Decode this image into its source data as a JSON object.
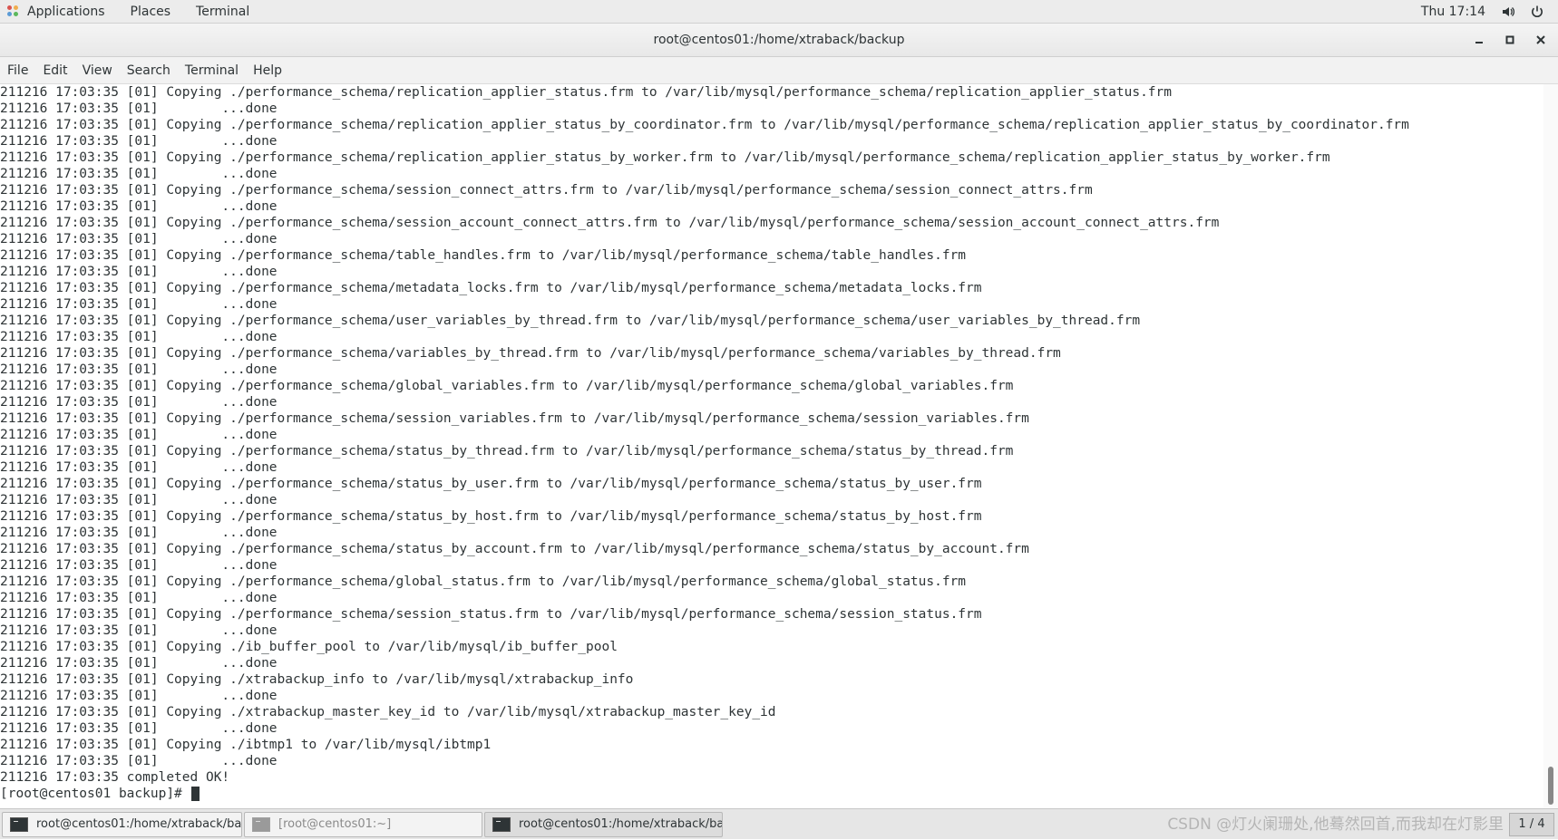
{
  "topbar": {
    "menu": [
      "Applications",
      "Places",
      "Terminal"
    ],
    "clock": "Thu 17:14",
    "icons": [
      "applications-icon",
      "volume-icon",
      "power-icon"
    ]
  },
  "window": {
    "title": "root@centos01:/home/xtraback/backup",
    "controls": [
      "minimize-icon",
      "maximize-icon",
      "close-icon"
    ]
  },
  "menubar": [
    "File",
    "Edit",
    "View",
    "Search",
    "Terminal",
    "Help"
  ],
  "terminal": {
    "lines": [
      "211216 17:03:35 [01] Copying ./performance_schema/replication_applier_status.frm to /var/lib/mysql/performance_schema/replication_applier_status.frm",
      "211216 17:03:35 [01]        ...done",
      "211216 17:03:35 [01] Copying ./performance_schema/replication_applier_status_by_coordinator.frm to /var/lib/mysql/performance_schema/replication_applier_status_by_coordinator.frm",
      "211216 17:03:35 [01]        ...done",
      "211216 17:03:35 [01] Copying ./performance_schema/replication_applier_status_by_worker.frm to /var/lib/mysql/performance_schema/replication_applier_status_by_worker.frm",
      "211216 17:03:35 [01]        ...done",
      "211216 17:03:35 [01] Copying ./performance_schema/session_connect_attrs.frm to /var/lib/mysql/performance_schema/session_connect_attrs.frm",
      "211216 17:03:35 [01]        ...done",
      "211216 17:03:35 [01] Copying ./performance_schema/session_account_connect_attrs.frm to /var/lib/mysql/performance_schema/session_account_connect_attrs.frm",
      "211216 17:03:35 [01]        ...done",
      "211216 17:03:35 [01] Copying ./performance_schema/table_handles.frm to /var/lib/mysql/performance_schema/table_handles.frm",
      "211216 17:03:35 [01]        ...done",
      "211216 17:03:35 [01] Copying ./performance_schema/metadata_locks.frm to /var/lib/mysql/performance_schema/metadata_locks.frm",
      "211216 17:03:35 [01]        ...done",
      "211216 17:03:35 [01] Copying ./performance_schema/user_variables_by_thread.frm to /var/lib/mysql/performance_schema/user_variables_by_thread.frm",
      "211216 17:03:35 [01]        ...done",
      "211216 17:03:35 [01] Copying ./performance_schema/variables_by_thread.frm to /var/lib/mysql/performance_schema/variables_by_thread.frm",
      "211216 17:03:35 [01]        ...done",
      "211216 17:03:35 [01] Copying ./performance_schema/global_variables.frm to /var/lib/mysql/performance_schema/global_variables.frm",
      "211216 17:03:35 [01]        ...done",
      "211216 17:03:35 [01] Copying ./performance_schema/session_variables.frm to /var/lib/mysql/performance_schema/session_variables.frm",
      "211216 17:03:35 [01]        ...done",
      "211216 17:03:35 [01] Copying ./performance_schema/status_by_thread.frm to /var/lib/mysql/performance_schema/status_by_thread.frm",
      "211216 17:03:35 [01]        ...done",
      "211216 17:03:35 [01] Copying ./performance_schema/status_by_user.frm to /var/lib/mysql/performance_schema/status_by_user.frm",
      "211216 17:03:35 [01]        ...done",
      "211216 17:03:35 [01] Copying ./performance_schema/status_by_host.frm to /var/lib/mysql/performance_schema/status_by_host.frm",
      "211216 17:03:35 [01]        ...done",
      "211216 17:03:35 [01] Copying ./performance_schema/status_by_account.frm to /var/lib/mysql/performance_schema/status_by_account.frm",
      "211216 17:03:35 [01]        ...done",
      "211216 17:03:35 [01] Copying ./performance_schema/global_status.frm to /var/lib/mysql/performance_schema/global_status.frm",
      "211216 17:03:35 [01]        ...done",
      "211216 17:03:35 [01] Copying ./performance_schema/session_status.frm to /var/lib/mysql/performance_schema/session_status.frm",
      "211216 17:03:35 [01]        ...done",
      "211216 17:03:35 [01] Copying ./ib_buffer_pool to /var/lib/mysql/ib_buffer_pool",
      "211216 17:03:35 [01]        ...done",
      "211216 17:03:35 [01] Copying ./xtrabackup_info to /var/lib/mysql/xtrabackup_info",
      "211216 17:03:35 [01]        ...done",
      "211216 17:03:35 [01] Copying ./xtrabackup_master_key_id to /var/lib/mysql/xtrabackup_master_key_id",
      "211216 17:03:35 [01]        ...done",
      "211216 17:03:35 [01] Copying ./ibtmp1 to /var/lib/mysql/ibtmp1",
      "211216 17:03:35 [01]        ...done",
      "211216 17:03:35 completed OK!"
    ],
    "prompt": "[root@centos01 backup]# "
  },
  "taskbar": {
    "tasks": [
      {
        "label": "root@centos01:/home/xtraback/ba...",
        "state": "normal"
      },
      {
        "label": "[root@centos01:~]",
        "state": "dim"
      },
      {
        "label": "root@centos01:/home/xtraback/bac...",
        "state": "active"
      }
    ],
    "watermark": "CSDN @灯火阑珊处,他蓦然回首,而我却在灯影里",
    "pager": "1 / 4"
  }
}
